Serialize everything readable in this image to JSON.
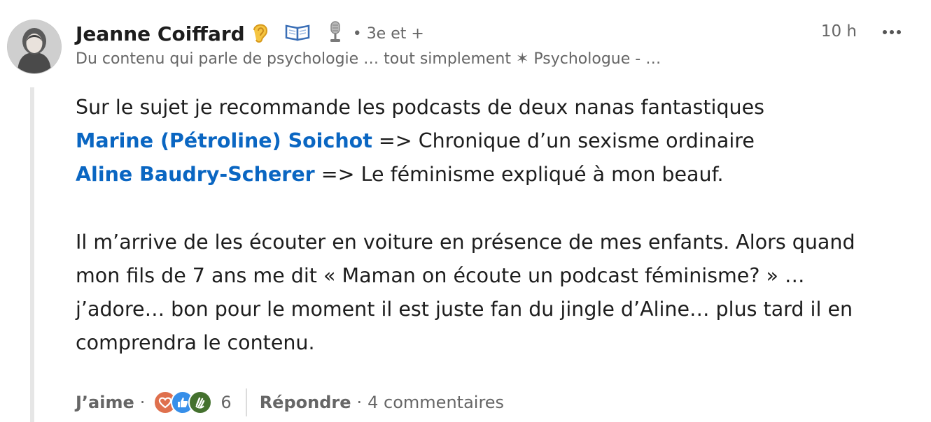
{
  "comment": {
    "author": {
      "name": "Jeanne Coiffard",
      "connection_degree": "• 3e et +"
    },
    "headline": "Du contenu qui parle de psychologie … tout simplement ✶ Psychologue - …",
    "timestamp": "10 h",
    "body": {
      "line1": "Sur le sujet je recommande les podcasts de deux nanas fantastiques",
      "mention1": "Marine (Pétroline) Soichot",
      "mention1_suffix": " => Chronique d’un sexisme ordinaire",
      "mention2": "Aline Baudry-Scherer",
      "mention2_suffix": " => Le féminisme expliqué à mon beauf.",
      "paragraph2_lines": [
        "Il m’arrive de les écouter en voiture en présence de mes enfants. Alors quand",
        "mon fils de 7 ans me dit « Maman on écoute un podcast féminisme? » …",
        "j’adore… bon pour le moment il est juste fan du jingle d’Aline… plus tard il en",
        "comprendra le contenu."
      ]
    },
    "actions": {
      "like_label": "J’aime",
      "dot": "·",
      "reaction_count": "6",
      "reply_label": "Répondre",
      "comments_text": "4 commentaires"
    },
    "colors": {
      "mention": "#0a66c2",
      "secondary_text": "#666666",
      "love": "#df704d",
      "like": "#378fe9",
      "celebrate": "#44712e"
    },
    "icons": [
      "ear-emoji-icon",
      "open-book-emoji-icon",
      "microphone-emoji-icon",
      "more-options-icon",
      "love-reaction-icon",
      "like-reaction-icon",
      "celebrate-reaction-icon"
    ]
  }
}
